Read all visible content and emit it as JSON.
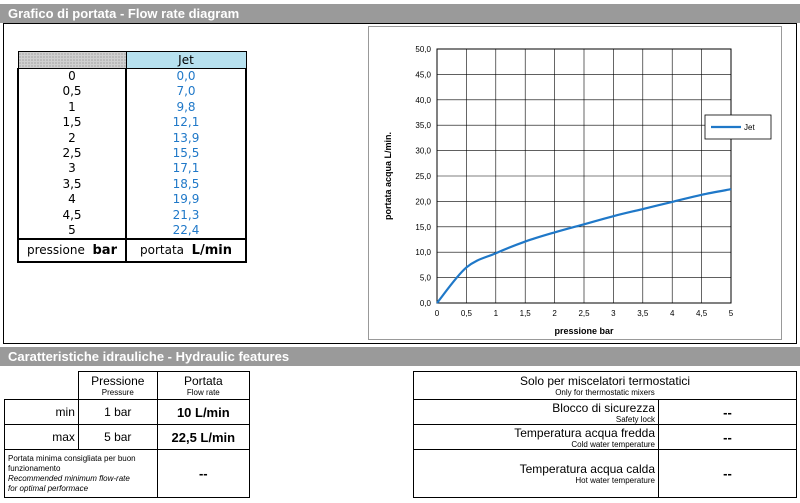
{
  "section1": {
    "title": "Grafico di portata - Flow rate diagram"
  },
  "section2": {
    "title": "Caratteristiche idrauliche - Hydraulic features"
  },
  "flow_table": {
    "header": "Jet",
    "pressures": [
      "0",
      "0,5",
      "1",
      "1,5",
      "2",
      "2,5",
      "3",
      "3,5",
      "4",
      "4,5",
      "5"
    ],
    "flows": [
      "0,0",
      "7,0",
      "9,8",
      "12,1",
      "13,9",
      "15,5",
      "17,1",
      "18,5",
      "19,9",
      "21,3",
      "22,4"
    ],
    "footer_left_prefix": "pressione",
    "footer_left_unit": "bar",
    "footer_right_prefix": "portata",
    "footer_right_unit": "L/min"
  },
  "chart_data": {
    "type": "line",
    "x": [
      0,
      0.5,
      1,
      1.5,
      2,
      2.5,
      3,
      3.5,
      4,
      4.5,
      5
    ],
    "series": [
      {
        "name": "Jet",
        "values": [
          0,
          7.0,
          9.8,
          12.1,
          13.9,
          15.5,
          17.1,
          18.5,
          19.9,
          21.3,
          22.4
        ],
        "color": "#1f78c8"
      }
    ],
    "xlabel": "pressione bar",
    "ylabel": "portata acqua  L/min.",
    "xlim": [
      0,
      5
    ],
    "ylim": [
      0,
      50
    ],
    "xticks": [
      "0",
      "0,5",
      "1",
      "1,5",
      "2",
      "2,5",
      "3",
      "3,5",
      "4",
      "4,5",
      "5"
    ],
    "yticks": [
      "0,0",
      "5,0",
      "10,0",
      "15,0",
      "20,0",
      "25,0",
      "30,0",
      "35,0",
      "40,0",
      "45,0",
      "50,0"
    ],
    "grid": true,
    "legend": "right"
  },
  "hydraulic": {
    "col1_title": "Pressione",
    "col1_sub": "Pressure",
    "col2_title": "Portata",
    "col2_sub": "Flow rate",
    "min_label": "min",
    "min_pressure": "1 bar",
    "min_flow": "10 L/min",
    "max_label": "max",
    "max_pressure": "5 bar",
    "max_flow": "22,5 L/min",
    "rec_it_1": "Portata minima consigliata per buon",
    "rec_it_2": "funzionamento",
    "rec_en_1": "Recommended minimum flow-rate",
    "rec_en_2": "for optimal performace",
    "rec_value": "--"
  },
  "thermo": {
    "title": "Solo per miscelatori termostatici",
    "subtitle": "Only for thermostatic mixers",
    "rows": [
      {
        "it": "Blocco di sicurezza",
        "en": "Safety lock",
        "value": "--"
      },
      {
        "it": "Temperatura acqua fredda",
        "en": "Cold water temperature",
        "value": "--"
      },
      {
        "it": "Temperatura acqua calda",
        "en": "Hot water temperature",
        "value": "--"
      }
    ]
  }
}
